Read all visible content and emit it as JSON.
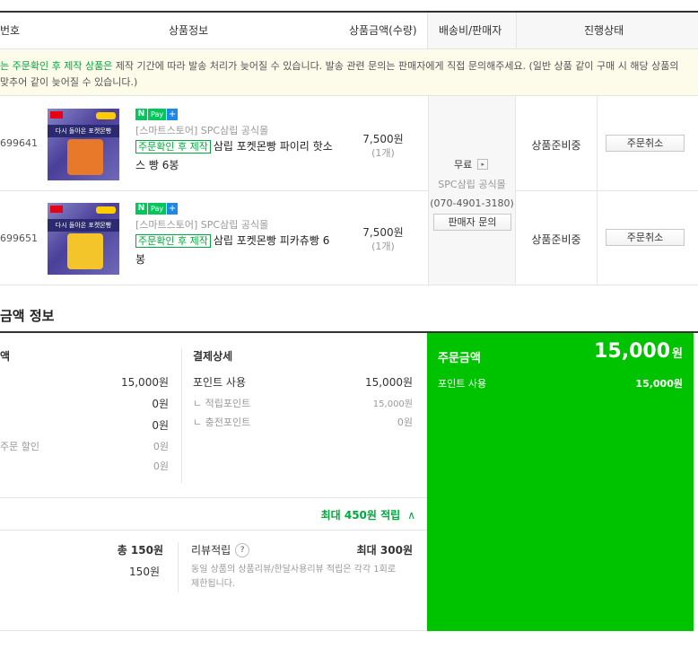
{
  "table_header": {
    "order_no": "번호",
    "product_info": "상품정보",
    "amount_qty": "상품금액(수량)",
    "shipping_seller": "배송비/판매자",
    "status": "진행상태"
  },
  "notice": {
    "highlight": "는 주문확인 후 제작 상품은",
    "text1": " 제작 기간에 따라 발송 처리가 늦어질 수 있습니다. 발송 관련 문의는 판매자에게 직접 문의해주세요. (일반 상품 같이 구매 시 해당 상품의",
    "text2": "맞추어 같이 늦어질 수 있습니다.)"
  },
  "items": [
    {
      "order_no": "699641",
      "badge_n": "N",
      "badge_pay": "Pay",
      "badge_plus": "+",
      "store": "[스마트스토어] SPC삼립 공식몰",
      "tag": "주문확인 후 제작",
      "name_line1": "삼립 포켓몬빵 파이리 핫소",
      "name_line2": "스 빵 6봉",
      "price": "7,500원",
      "qty": "(1개)",
      "status": "상품준비중",
      "cancel": "주문취소",
      "thumb_band": "다시 돌아온 포켓몬빵",
      "pack_color": "#e8782a"
    },
    {
      "order_no": "699651",
      "badge_n": "N",
      "badge_pay": "Pay",
      "badge_plus": "+",
      "store": "[스마트스토어] SPC삼립 공식몰",
      "tag": "주문확인 후 제작",
      "name_line1": "삼립 포켓몬빵 피카츄빵 6",
      "name_line2": "봉",
      "price": "7,500원",
      "qty": "(1개)",
      "status": "상품준비중",
      "cancel": "주문취소",
      "thumb_band": "다시 돌아온 포켓몬빵",
      "pack_color": "#f4c52a"
    }
  ],
  "shipping": {
    "fee": "무료",
    "arrow": "▸",
    "seller": "SPC삼립 공식몰",
    "phone": "(070-4901-3180)",
    "inquiry": "판매자 문의"
  },
  "payment_section": {
    "title": "금액 정보",
    "left_header": "액",
    "left_values": [
      "15,000원",
      "0원",
      "0원",
      "0원",
      "0원"
    ],
    "left_discount_label": "주문 할인",
    "detail_header": "결제상세",
    "point_use_label": "포인트 사용",
    "point_use_value": "15,000원",
    "earned_point_label": "ㄴ 적립포인트",
    "earned_point_value": "15,000원",
    "charge_point_label": "ㄴ 충전포인트",
    "charge_point_value": "0원",
    "max_reward": "최대 450원 적립",
    "chevron": "∧",
    "total_label": "총 150원",
    "total_sub": "150원",
    "review_label": "리뷰적립",
    "review_help": "?",
    "review_max": "최대 300원",
    "review_note1": "동일 상품의 상품리뷰/한달사용리뷰 적립은 각각 1회로",
    "review_note2": "제한됩니다."
  },
  "order_total": {
    "label": "주문금액",
    "amount": "15,000",
    "unit": "원",
    "point_label": "포인트 사용",
    "point_value": "15,000원"
  }
}
